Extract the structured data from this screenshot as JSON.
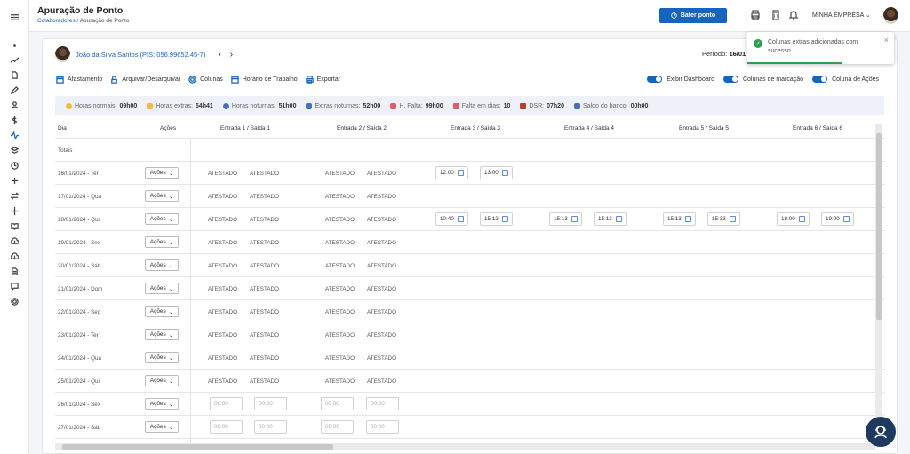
{
  "header": {
    "title": "Apuração de Ponto",
    "breadcrumb_link": "Colaboradores",
    "breadcrumb_sep": "/",
    "breadcrumb_current": "Apuração de Ponto",
    "bater_ponto": "Bater ponto",
    "company": "MINHA EMPRESA"
  },
  "employee": {
    "name": "João da Silva Santos (PIS: 056.99652.45-7)",
    "periodo_label": "Período:",
    "periodo_value": "16/01/"
  },
  "toolbar": {
    "afastamento": "Afastamento",
    "arquivar": "Arquivar/Desarquivar",
    "colunas": "Colunas",
    "horario": "Horário de Trabalho",
    "exportar": "Exportar"
  },
  "toggles": {
    "dashboard": "Exibir Dashboard",
    "marcacao": "Colunas de marcação",
    "acoes": "Coluna de Ações"
  },
  "dashboard": {
    "normais_label": "Horas normais:",
    "normais": "09h00",
    "extras_label": "Horas extras:",
    "extras": "54h41",
    "noturnas_label": "Horas noturnas:",
    "noturnas": "51h00",
    "extras_not_label": "Extras noturnas:",
    "extras_not": "52h00",
    "falta_label": "H. Falta:",
    "falta": "99h00",
    "falta_dias_label": "Falta em dias:",
    "falta_dias": "10",
    "dsr_label": "DSR:",
    "dsr": "07h20",
    "saldo_label": "Saldo do banco:",
    "saldo": "00h00"
  },
  "table": {
    "headers": {
      "dia": "Dia",
      "acoes": "Ações",
      "c1": "Entrada 1 / Saída 1",
      "c2": "Entrada 2 / Saída 2",
      "c3": "Entrada 3 / Saída 3",
      "c4": "Entrada 4 / Saída 4",
      "c5": "Entrada 5 / Saída 5",
      "c6": "Entrada 6 / Saída 6"
    },
    "totais": "Totais",
    "acoes_label": "Ações",
    "rows": [
      {
        "dia": "16/01/2024 - Ter",
        "v": [
          "ATESTADO",
          "ATESTADO",
          "ATESTADO",
          "ATESTADO"
        ],
        "t": [
          "12:00",
          "13:00"
        ]
      },
      {
        "dia": "17/01/2024 - Qua",
        "v": [
          "ATESTADO",
          "ATESTADO",
          "ATESTADO",
          "ATESTADO"
        ],
        "t": []
      },
      {
        "dia": "18/01/2024 - Qui",
        "v": [
          "ATESTADO",
          "ATESTADO",
          "ATESTADO",
          "ATESTADO"
        ],
        "t": [
          "10:40",
          "15:12",
          "15:13",
          "15:13",
          "15:13",
          "15:33",
          "18:00",
          "19:00"
        ]
      },
      {
        "dia": "19/01/2024 - Sex",
        "v": [
          "ATESTADO",
          "ATESTADO",
          "ATESTADO",
          "ATESTADO"
        ],
        "t": []
      },
      {
        "dia": "20/01/2024 - Sáb",
        "v": [
          "ATESTADO",
          "ATESTADO",
          "ATESTADO",
          "ATESTADO"
        ],
        "t": []
      },
      {
        "dia": "21/01/2024 - Dom",
        "v": [
          "ATESTADO",
          "ATESTADO",
          "ATESTADO",
          "ATESTADO"
        ],
        "t": []
      },
      {
        "dia": "22/01/2024 - Seg",
        "v": [
          "ATESTADO",
          "ATESTADO",
          "ATESTADO",
          "ATESTADO"
        ],
        "t": []
      },
      {
        "dia": "23/01/2024 - Ter",
        "v": [
          "ATESTADO",
          "ATESTADO",
          "ATESTADO",
          "ATESTADO"
        ],
        "t": []
      },
      {
        "dia": "24/01/2024 - Qua",
        "v": [
          "ATESTADO",
          "ATESTADO",
          "ATESTADO",
          "ATESTADO"
        ],
        "t": []
      },
      {
        "dia": "25/01/2024 - Qui",
        "v": [
          "ATESTADO",
          "ATESTADO",
          "ATESTADO",
          "ATESTADO"
        ],
        "t": []
      },
      {
        "dia": "26/01/2024 - Sex",
        "v": [],
        "t": [],
        "empty": "00:00"
      },
      {
        "dia": "27/01/2024 - Sáb",
        "v": [],
        "t": [],
        "empty": "00:00"
      }
    ]
  },
  "toast": {
    "message": "Colunas extras adicionadas com sucesso."
  },
  "colors": {
    "primary": "#1565c0",
    "success": "#2e9e4f",
    "dark": "#1f3a5f"
  }
}
